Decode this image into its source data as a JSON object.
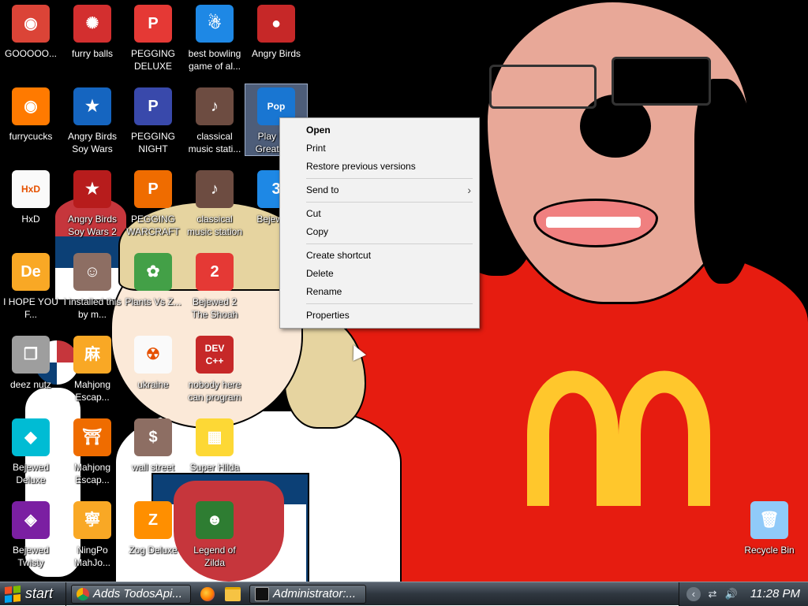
{
  "desktop": {
    "icons": [
      {
        "label": "GOOOOO...",
        "glyph": "◉",
        "color": "#db4437"
      },
      {
        "label": "furry balls",
        "glyph": "✺",
        "color": "#d32f2f"
      },
      {
        "label": "PEGGING DELUXE",
        "glyph": "P",
        "color": "#e53935"
      },
      {
        "label": "best bowling game of al...",
        "glyph": "☃",
        "color": "#1e88e5"
      },
      {
        "label": "Angry Birds",
        "glyph": "●",
        "color": "#c62828"
      },
      {
        "label": "furrycucks",
        "glyph": "◉",
        "color": "#ff7a00"
      },
      {
        "label": "Angry Birds Soy Wars",
        "glyph": "★",
        "color": "#1565c0"
      },
      {
        "label": "PEGGING NIGHT",
        "glyph": "P",
        "color": "#3949ab"
      },
      {
        "label": "classical music stati...",
        "glyph": "♪",
        "color": "#6d4c41"
      },
      {
        "label": "Play M... Great G...",
        "glyph": "Pop",
        "color": "#1976d2"
      },
      {
        "label": "HxD",
        "glyph": "HxD",
        "color": "#fafafa"
      },
      {
        "label": "Angry Birds Soy Wars 2",
        "glyph": "★",
        "color": "#b71c1c"
      },
      {
        "label": "PEGGING WARCRAFT",
        "glyph": "P",
        "color": "#ef6c00"
      },
      {
        "label": "classical music station",
        "glyph": "♪",
        "color": "#6d4c41"
      },
      {
        "label": "Bejewe...",
        "glyph": "3",
        "color": "#1e88e5"
      },
      {
        "label": "I HOPE YOU F...",
        "glyph": "De",
        "color": "#f9a825"
      },
      {
        "label": "I installed this by m...",
        "glyph": "☺",
        "color": "#8d6e63"
      },
      {
        "label": "Plants Vs Z...",
        "glyph": "✿",
        "color": "#43a047"
      },
      {
        "label": "Bejewed 2 The Shoah",
        "glyph": "2",
        "color": "#e53935"
      },
      {
        "label": "deez nutz",
        "glyph": "❐",
        "color": "#9e9e9e"
      },
      {
        "label": "Mahjong Escap...",
        "glyph": "麻",
        "color": "#f9a825"
      },
      {
        "label": "ukraine",
        "glyph": "☢",
        "color": "#fafafa"
      },
      {
        "label": "nobody here can program",
        "glyph": "DEV C++",
        "color": "#c62828"
      },
      {
        "label": "Bejewed Deluxe",
        "glyph": "◆",
        "color": "#00bcd4"
      },
      {
        "label": "Mahjong Escap...",
        "glyph": "⛩",
        "color": "#ef6c00"
      },
      {
        "label": "wall street",
        "glyph": "$",
        "color": "#8d6e63"
      },
      {
        "label": "Super Hilda",
        "glyph": "▦",
        "color": "#fdd835"
      },
      {
        "label": "Bejewed Twisty",
        "glyph": "◈",
        "color": "#7b1fa2"
      },
      {
        "label": "NingPo MahJo...",
        "glyph": "寧",
        "color": "#f9a825"
      },
      {
        "label": "Zog Deluxe",
        "glyph": "Z",
        "color": "#ff8f00"
      },
      {
        "label": "Legend of Zilda",
        "glyph": "☻",
        "color": "#2e7d32"
      },
      {
        "label": "Recycle Bin",
        "glyph": "🗑",
        "color": "#90caf9"
      }
    ]
  },
  "context_menu": {
    "items": [
      {
        "label": "Open",
        "bold": true
      },
      {
        "label": "Print"
      },
      {
        "label": "Restore previous versions"
      },
      {
        "sep": true
      },
      {
        "label": "Send to",
        "submenu": true
      },
      {
        "sep": true
      },
      {
        "label": "Cut"
      },
      {
        "label": "Copy"
      },
      {
        "sep": true
      },
      {
        "label": "Create shortcut"
      },
      {
        "label": "Delete"
      },
      {
        "label": "Rename"
      },
      {
        "sep": true
      },
      {
        "label": "Properties"
      }
    ],
    "submenu_arrow": "›"
  },
  "taskbar": {
    "start_label": "start",
    "buttons": [
      {
        "label": "Adds TodosApi...",
        "icon": "chrome-icon",
        "color": "#db4437"
      },
      {
        "label": "Administrator:...",
        "icon": "console-icon",
        "color": "#222222"
      }
    ],
    "quicklaunch": [
      {
        "icon": "firefox-icon",
        "glyph": "◉",
        "color": "#ff7a00"
      },
      {
        "icon": "folder-icon",
        "glyph": "▬",
        "color": "#f6c343"
      }
    ],
    "tray": {
      "icons": [
        {
          "icon": "network-icon",
          "glyph": "⇄"
        },
        {
          "icon": "volume-icon",
          "glyph": "🔊"
        }
      ],
      "collapse_glyph": "‹",
      "clock": "11:28 PM"
    }
  },
  "colors": {
    "menu_bg": "#f2f2f2",
    "taskbar_dark": "#20262c",
    "shirt_red": "#e61c10",
    "arch_yellow": "#ffc72c"
  }
}
